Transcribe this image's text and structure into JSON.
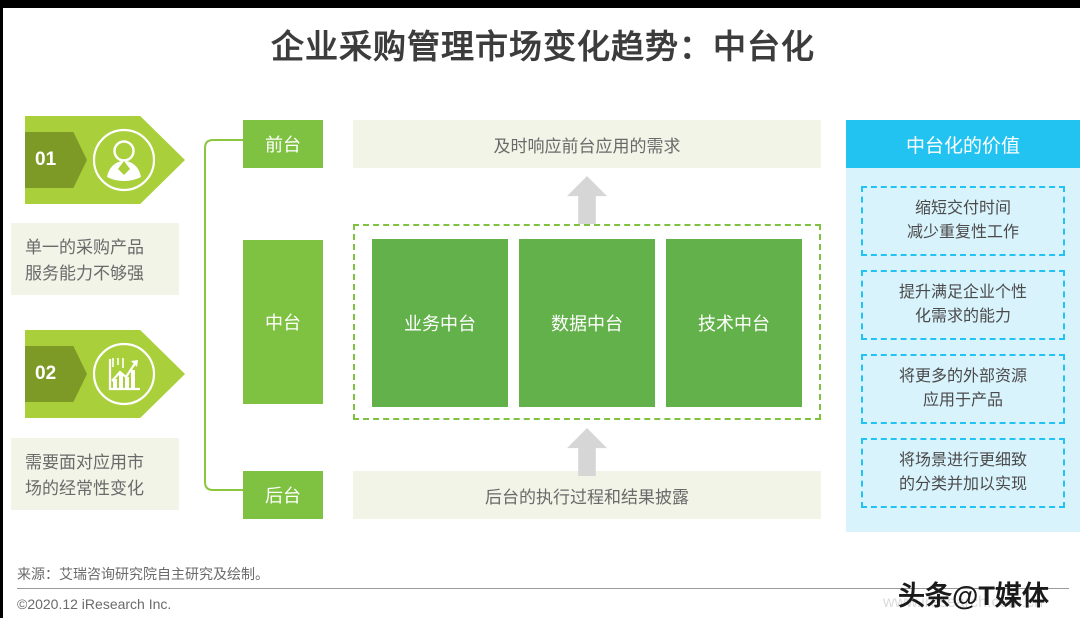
{
  "page": {
    "title": "企业采购管理市场变化趋势：中台化",
    "accent_green": "#7fc241",
    "accent_green_light": "#a9cf3b",
    "accent_green_dark": "#63b14b",
    "accent_olive": "#7d9a27",
    "accent_blue": "#23c3f1",
    "panel_blue_bg": "#d9f3fc",
    "band_bg": "#f1f4e7",
    "arrow_gray": "#d6d6d6",
    "title_color": "#3c3c3c"
  },
  "left_column": {
    "items": [
      {
        "number": "01",
        "icon": "person-icon",
        "text_line1": "单一的采购产品",
        "text_line2": "服务能力不够强"
      },
      {
        "number": "02",
        "icon": "bar-chart-trend-icon",
        "text_line1": "需要面对应用市",
        "text_line2": "场的经常性变化"
      }
    ]
  },
  "stages": {
    "front": "前台",
    "middle": "中台",
    "back": "后台"
  },
  "bands": {
    "top": "及时响应前台应用的需求",
    "bottom": "后台的执行过程和结果披露"
  },
  "middle_platform": {
    "cards": [
      {
        "label": "业务中台"
      },
      {
        "label": "数据中台"
      },
      {
        "label": "技术中台"
      }
    ]
  },
  "right_panel": {
    "header": "中台化的价值",
    "cards": [
      {
        "line1": "缩短交付时间",
        "line2": "减少重复性工作"
      },
      {
        "line1": "提升满足企业个性",
        "line2": "化需求的能力"
      },
      {
        "line1": "将更多的外部资源",
        "line2": "应用于产品"
      },
      {
        "line1": "将场景进行更细致",
        "line2": "的分类并加以实现"
      }
    ]
  },
  "footer": {
    "source": "来源：艾瑞咨询研究院自主研究及绘制。",
    "copyright": "©2020.12 iResearch Inc.",
    "watermark_site": "www.iresearch.com.cn",
    "watermark_brand": "头条@T媒体"
  }
}
